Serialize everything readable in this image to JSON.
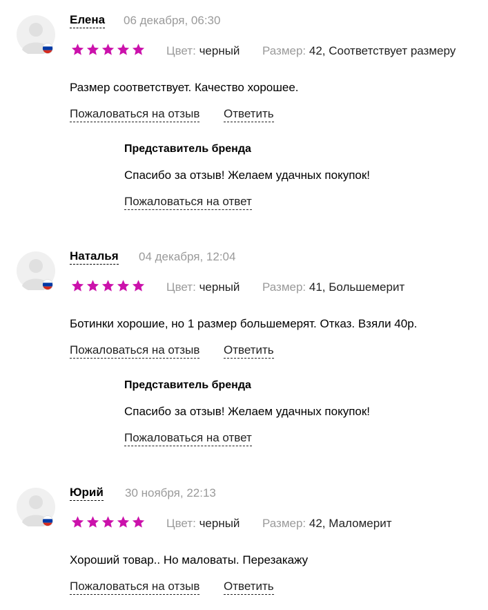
{
  "colors": {
    "star": "#cb11ab",
    "muted": "#9a9a9a",
    "text": "#000000"
  },
  "labels": {
    "color": "Цвет:",
    "size": "Размер:",
    "complain_review": "Пожаловаться на отзыв",
    "reply": "Ответить",
    "complain_reply": "Пожаловаться на ответ"
  },
  "reviews": [
    {
      "author": "Елена",
      "date": "06 декабря, 06:30",
      "rating": 5,
      "color_value": "черный",
      "size_value": "42, Соответствует размеру",
      "text": "Размер соответствует. Качество хорошее.",
      "reply": {
        "author": "Представитель бренда",
        "text": "Спасибо за отзыв! Желаем удачных покупок!"
      }
    },
    {
      "author": "Наталья",
      "date": "04 декабря, 12:04",
      "rating": 5,
      "color_value": "черный",
      "size_value": "41, Большемерит",
      "text": "Ботинки хорошие, но 1 размер большемерят. Отказ. Взяли 40р.",
      "reply": {
        "author": "Представитель бренда",
        "text": "Спасибо за отзыв! Желаем удачных покупок!"
      }
    },
    {
      "author": "Юрий",
      "date": "30 ноября, 22:13",
      "rating": 5,
      "color_value": "черный",
      "size_value": "42, Маломерит",
      "text": "Хороший товар.. Но маловаты. Перезакажу"
    }
  ]
}
